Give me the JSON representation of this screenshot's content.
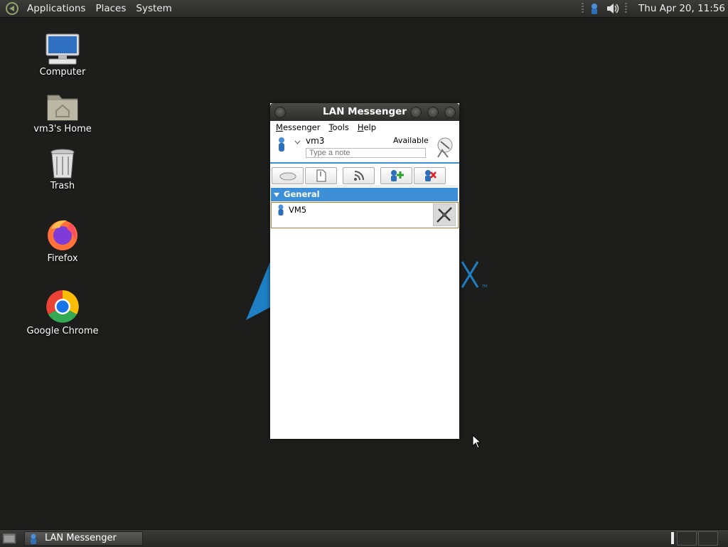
{
  "top_panel": {
    "menus": [
      "Applications",
      "Places",
      "System"
    ],
    "clock": "Thu Apr 20, 11:56"
  },
  "desktop": {
    "icons": [
      {
        "label": "Computer",
        "icon": "computer-icon"
      },
      {
        "label": "vm3's Home",
        "icon": "home-folder-icon"
      },
      {
        "label": "Trash",
        "icon": "trash-icon"
      },
      {
        "label": "Firefox",
        "icon": "firefox-icon"
      },
      {
        "label": "Google Chrome",
        "icon": "chrome-icon"
      }
    ]
  },
  "window": {
    "title": "LAN Messenger",
    "menu": [
      "Messenger",
      "Tools",
      "Help"
    ],
    "user": {
      "name": "vm3",
      "status": "Available",
      "note_placeholder": "Type a note"
    },
    "toolbar": [
      "broadcast-icon",
      "file-icon",
      "rss-icon",
      "add-contact-icon",
      "remove-contact-icon"
    ],
    "group": {
      "name": "General",
      "contacts": [
        {
          "name": "VM5"
        }
      ]
    }
  },
  "taskbar": {
    "task_label": "LAN Messenger"
  },
  "colors": {
    "accent": "#3d8fd8",
    "desktop_bg": "#1d1e1c",
    "contact_border": "#a37e3b"
  }
}
